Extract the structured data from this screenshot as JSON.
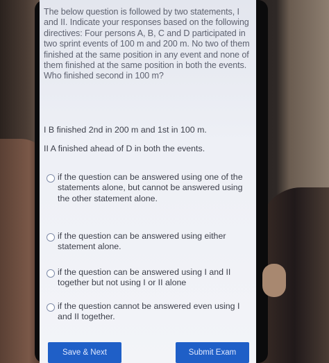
{
  "question": {
    "text": "The below question is followed by two statements, I and II. Indicate your responses based on the following directives: Four persons A, B, C and D participated in two sprint events of 100 m and 200 m. No two of them finished at the same position in any event and none of them finished at the same position in both the events. Who finished second in 100 m?"
  },
  "statements": [
    {
      "text": "I B finished 2nd in 200 m and 1st in 100 m."
    },
    {
      "text": "II A finished ahead of D in both the events."
    }
  ],
  "options": [
    {
      "text": "if the question can be answered using one of the statements alone, but cannot be answered using the other statement alone."
    },
    {
      "text": "if the question can be answered using either statement alone."
    },
    {
      "text": "if the question can be answered using I and II together but not using I or II alone"
    },
    {
      "text": "if the question cannot be answered even using I and II together."
    }
  ],
  "buttons": {
    "save_next": "Save & Next",
    "submit": "Submit Exam"
  },
  "colors": {
    "button": "#1f5fc7",
    "radio_border": "#7d8aa8",
    "screen": "#eef0f6"
  },
  "icons": {
    "radio": "radio-circle-icon"
  }
}
